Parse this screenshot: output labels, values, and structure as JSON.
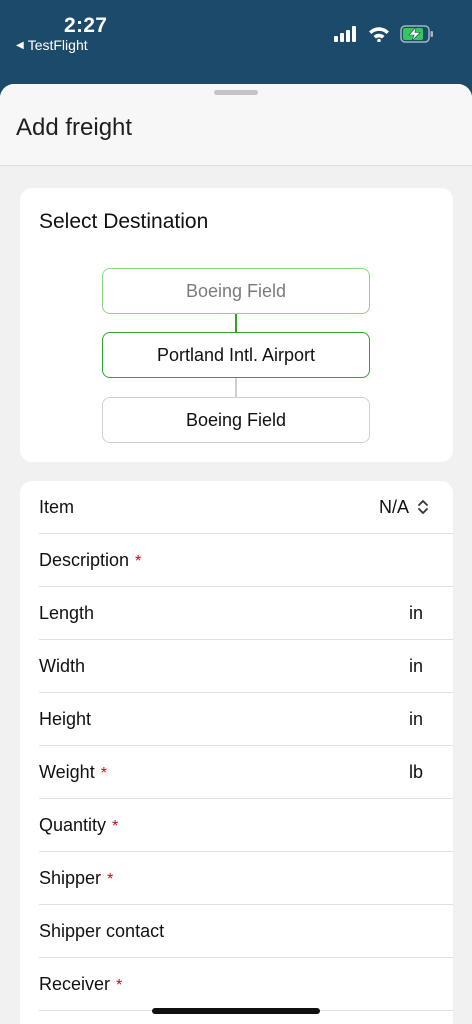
{
  "status_bar": {
    "time": "2:27",
    "back_app": "TestFlight",
    "back_icon": "back-triangle-icon",
    "signal_icon": "cellular-signal-icon",
    "wifi_icon": "wifi-icon",
    "battery_icon": "battery-charging-icon",
    "battery_color": "#34c759"
  },
  "sheet": {
    "title": "Add freight"
  },
  "destination": {
    "title": "Select Destination",
    "previous": "Boeing Field",
    "current": "Portland Intl. Airport",
    "next": "Boeing Field",
    "accent_color": "#2ea52a"
  },
  "form": {
    "rows": [
      {
        "label": "Item",
        "value": "N/A",
        "required": ""
      },
      {
        "label": "Description",
        "required": "*"
      },
      {
        "label": "Length",
        "unit": "in",
        "required": ""
      },
      {
        "label": "Width",
        "unit": "in",
        "required": ""
      },
      {
        "label": "Height",
        "unit": "in",
        "required": ""
      },
      {
        "label": "Weight",
        "unit": "lb",
        "required": "*"
      },
      {
        "label": "Quantity",
        "required": "*"
      },
      {
        "label": "Shipper",
        "required": "*"
      },
      {
        "label": "Shipper contact",
        "required": ""
      },
      {
        "label": "Receiver",
        "required": "*"
      }
    ],
    "required_color": "#d0021b"
  }
}
